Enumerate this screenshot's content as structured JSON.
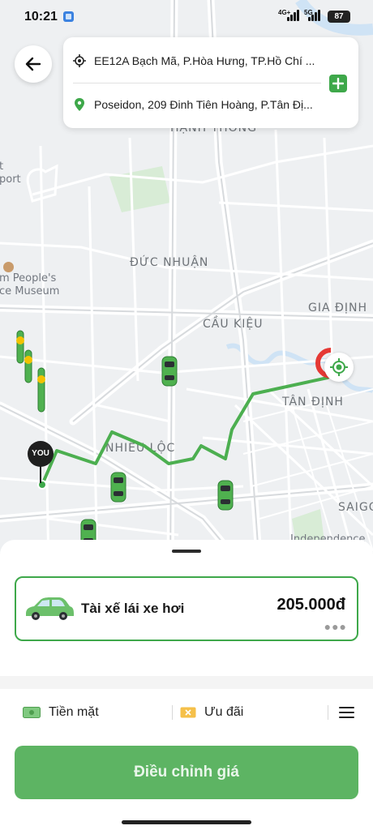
{
  "status_bar": {
    "time": "10:21",
    "network_primary": "4G+",
    "network_secondary": "5G",
    "battery": "87"
  },
  "route": {
    "pickup": "EE12A Bạch Mã, P.Hòa Hưng, TP.Hồ Chí ...",
    "destination": "Poseidon, 209 Đinh Tiên Hoàng, P.Tân Đị..."
  },
  "map": {
    "labels": {
      "hanh_thong": "HẠNH THÔNG",
      "duc_nhuan": "ĐỨC NHUẬN",
      "cau_kieu": "CẦU KIỆU",
      "gia_dinh": "GIA ĐỊNH",
      "tan_dinh": "TÂN ĐỊNH",
      "nhieu_loc": "NHIÊU LỘC",
      "saigon": "SAIGO",
      "airport_1": "t",
      "airport_2": "port",
      "museum_1": "m People's",
      "museum_2": "ce Museum",
      "independence": "Independence"
    },
    "you_marker": "YOU",
    "route_color": "#4caf50"
  },
  "sheet": {
    "service_name": "Tài xế lái xe hơi",
    "service_price": "205.000đ",
    "payment_method": "Tiền mặt",
    "promotion": "Ưu đãi",
    "adjust_price_button": "Điều chỉnh giá"
  },
  "colors": {
    "accent": "#3ea84a",
    "button": "#5db463"
  }
}
